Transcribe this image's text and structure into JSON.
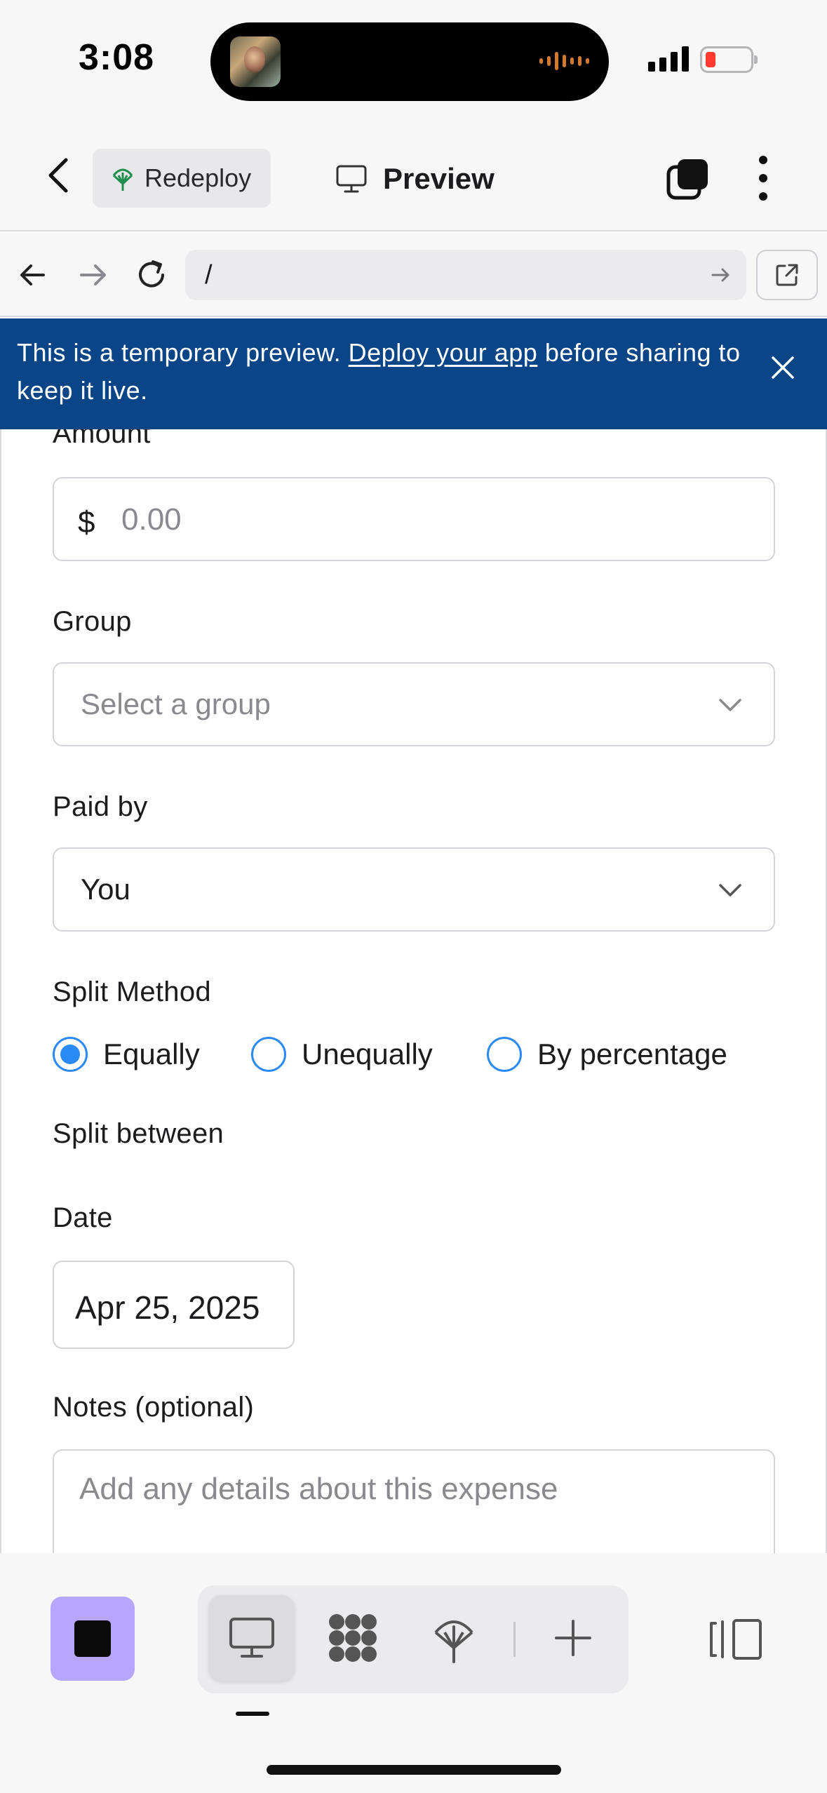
{
  "status": {
    "time": "3:08",
    "battery_color": "#ff3b30"
  },
  "appbar": {
    "redeploy_label": "Redeploy",
    "preview_label": "Preview"
  },
  "browser": {
    "url_value": "/"
  },
  "banner": {
    "text_before": "This is a temporary preview. ",
    "link_text": "Deploy your app",
    "text_after": " before sharing to keep it live.",
    "background": "#0a4587"
  },
  "form": {
    "amount": {
      "label": "Amount",
      "currency": "$",
      "placeholder": "0.00"
    },
    "group": {
      "label": "Group",
      "placeholder": "Select a group"
    },
    "paid_by": {
      "label": "Paid by",
      "value": "You"
    },
    "split_method": {
      "label": "Split Method",
      "options": [
        {
          "label": "Equally",
          "selected": true
        },
        {
          "label": "Unequally",
          "selected": false
        },
        {
          "label": "By percentage",
          "selected": false
        }
      ],
      "accent": "#2a8af6"
    },
    "split_between": {
      "label": "Split between"
    },
    "date": {
      "label": "Date",
      "value": "Apr 25, 2025"
    },
    "notes": {
      "label": "Notes (optional)",
      "placeholder": "Add any details about this expense"
    }
  },
  "toolbar": {
    "stop_color": "#b7a6ff",
    "tools": [
      "desktop-icon",
      "apps-grid-icon",
      "deploy-icon",
      "add-icon"
    ],
    "active_tool": "desktop-icon"
  }
}
